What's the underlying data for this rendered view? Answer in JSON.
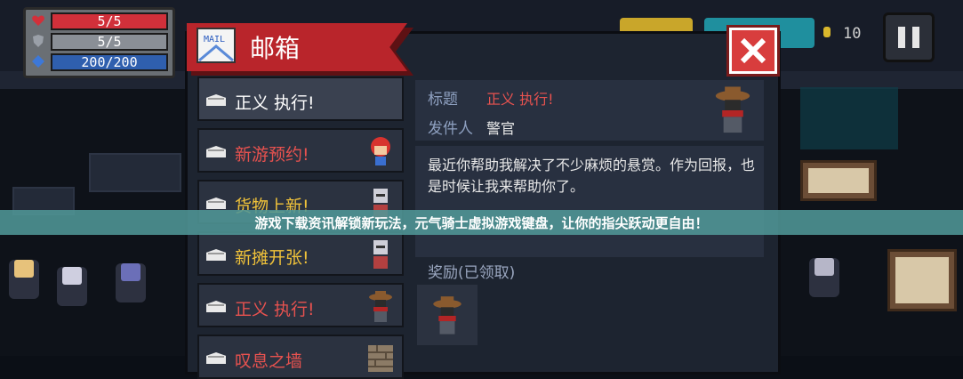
{
  "hud": {
    "hp": {
      "text": "5/5",
      "fraction": 1.0,
      "color": "#d1303a"
    },
    "armor": {
      "text": "5/5",
      "fraction": 1.0,
      "color": "#8a8f96"
    },
    "energy": {
      "text": "200/200",
      "fraction": 1.0,
      "color": "#2f5fae"
    },
    "coins": "10",
    "icons": {
      "hp": "heart-icon",
      "armor": "shield-icon",
      "energy": "energy-gem-icon",
      "coin": "coin-icon",
      "pause": "pause-icon"
    }
  },
  "mailbox": {
    "title": "邮箱",
    "icon": "mail-letter-icon",
    "mail_icon_text": "MAIL",
    "close_icon": "close-x-icon",
    "accent": "#b9252b",
    "items": [
      {
        "label": "正义 执行!",
        "color": "#ffffff",
        "sprite": "none"
      },
      {
        "label": "新游预约!",
        "color": "#e8524f",
        "sprite": "red-hair-npc"
      },
      {
        "label": "货物上新!",
        "color": "#f0c23a",
        "sprite": "knight-npc"
      },
      {
        "label": "新摊开张!",
        "color": "#f0c23a",
        "sprite": "knight-npc"
      },
      {
        "label": "正义 执行!",
        "color": "#e8524f",
        "sprite": "sheriff-npc"
      },
      {
        "label": "叹息之墙",
        "color": "#e8524f",
        "sprite": "wall-icon"
      }
    ],
    "detail": {
      "title_label": "标题",
      "title_value": "正义 执行!",
      "sender_label": "发件人",
      "sender_value": "警官",
      "body": "最近你帮助我解决了不少麻烦的悬赏。作为回报，也是时候让我来帮助你了。",
      "reward_label": "奖励(已领取)",
      "sender_sprite": "sheriff-npc",
      "reward_sprite": "sheriff-npc"
    }
  },
  "banner": {
    "text": "游戏下载资讯解锁新玩法，元气骑士虚拟游戏键盘，让你的指尖跃动更自由！"
  }
}
